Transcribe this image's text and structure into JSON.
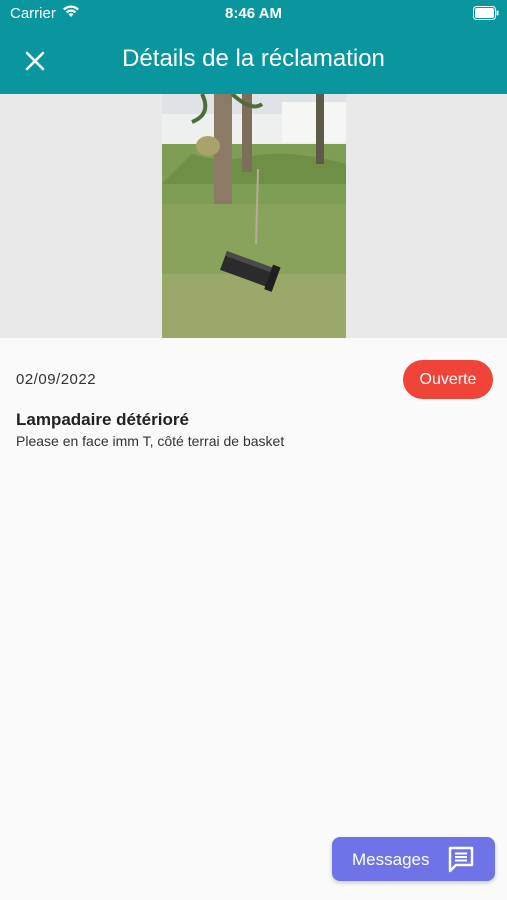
{
  "status_bar": {
    "carrier": "Carrier",
    "time": "8:46 AM"
  },
  "header": {
    "title": "Détails de la réclamation"
  },
  "claim": {
    "date": "02/09/2022",
    "status": "Ouverte",
    "status_color": "#f04438",
    "title": "Lampadaire détérioré",
    "description": "Please en face imm T, côté terrai de basket"
  },
  "actions": {
    "messages_label": "Messages"
  },
  "colors": {
    "header": "#0a969f",
    "messages_button": "#6e74e8"
  }
}
